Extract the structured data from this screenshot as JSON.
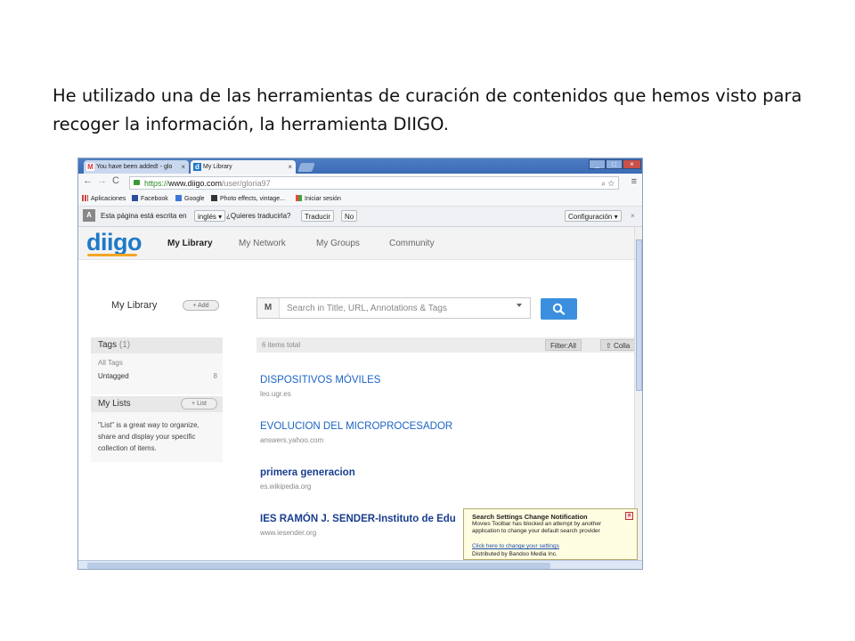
{
  "caption": "He utilizado una de las herramientas de curación de contenidos que hemos visto para recoger la información, la herramienta DIIGO.",
  "browser": {
    "tabs": [
      {
        "label": "You have been added! - glo",
        "icon": "M"
      },
      {
        "label": "My Library",
        "icon": "d"
      }
    ],
    "tab_close": "×",
    "window_buttons": {
      "minimize": "_",
      "maximize": "□",
      "close": "×"
    },
    "nav": {
      "back": "←",
      "forward": "→",
      "reload": "C"
    },
    "url": {
      "scheme": "https://",
      "host": "www.diigo.com",
      "path": "/user/gloria97"
    },
    "url_icons": "⌕ ☆",
    "menu_icon": "≡",
    "bookmarks": [
      "Aplicaciones",
      "Facebook",
      "Google",
      "Photo effects, vintage...",
      "Iniciar sesión"
    ],
    "translate_bar": {
      "text": "Esta página está escrita en",
      "language": "inglés",
      "question": "¿Quieres traducirla?",
      "translate_button": "Traducir",
      "no_button": "No",
      "settings": "Configuración",
      "close": "×"
    }
  },
  "diigo": {
    "logo": "diigo",
    "nav": [
      "My Library",
      "My Network",
      "My Groups",
      "Community"
    ],
    "sidebar": {
      "title": "My Library",
      "add_button": "+ Add",
      "tags_header": "Tags",
      "tags_count": "(1)",
      "all_tags": "All Tags",
      "tag_name": "Untagged",
      "tag_count": "8",
      "lists_header": "My Lists",
      "list_button": "+ List",
      "lists_info": "\"List\" is a great way to organize, share and display your specific collection of items."
    },
    "search": {
      "prefix": "M",
      "placeholder": "Search in Title, URL, Annotations & Tags"
    },
    "items_total": "6 items total",
    "filter": "Filter:All",
    "collapse": "Colla",
    "items": [
      {
        "title": "DISPOSITIVOS MÓVILES",
        "url": "leo.ugr.es"
      },
      {
        "title": "EVOLUCION DEL MICROPROCESADOR",
        "url": "answers.yahoo.com"
      },
      {
        "title": "primera generacion",
        "url": "es.wikipedia.org"
      },
      {
        "title": "IES RAMÓN J. SENDER-Instituto de Edu",
        "url": "www.iesender.org"
      }
    ]
  },
  "notification": {
    "title": "Search Settings Change Notification",
    "body": "Movies Toolbar has blocked an attempt by another application to change your default search provider",
    "link": "Click here to change your settings",
    "footer": "Distributed by Bandoo Media Inc.",
    "close": "×"
  },
  "colors": {
    "diigo_blue": "#1f7ac7",
    "search_button": "#3b8fde",
    "title_bar": "#3a6bb5",
    "popup_bg": "#fffde1"
  }
}
